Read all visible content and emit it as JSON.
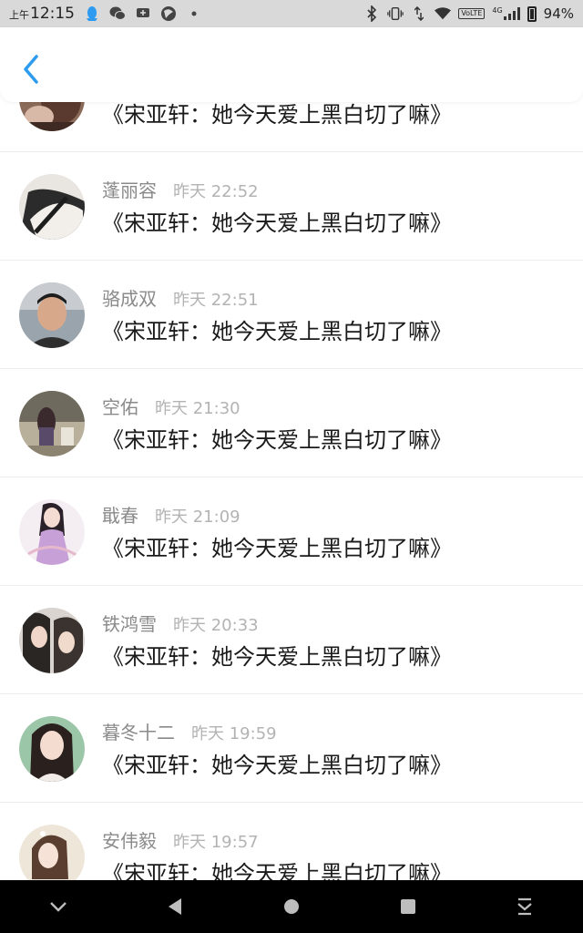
{
  "status_bar": {
    "ampm": "上午",
    "time": "12:15",
    "network": "4G",
    "volte": "VoLTE",
    "battery": "94%"
  },
  "header": {
    "back_icon": "chevron-left-icon",
    "accent": "#2d9cf0"
  },
  "comments": [
    {
      "name": "",
      "time": "",
      "text": "《宋亚轩：她今天爱上黑白切了嘛》"
    },
    {
      "name": "蓬丽容",
      "time": "昨天 22:52",
      "text": "《宋亚轩：她今天爱上黑白切了嘛》"
    },
    {
      "name": "骆成双",
      "time": "昨天 22:51",
      "text": "《宋亚轩：她今天爱上黑白切了嘛》"
    },
    {
      "name": "空佑",
      "time": "昨天 21:30",
      "text": "《宋亚轩：她今天爱上黑白切了嘛》"
    },
    {
      "name": "戢春",
      "time": "昨天 21:09",
      "text": "《宋亚轩：她今天爱上黑白切了嘛》"
    },
    {
      "name": "铁鸿雪",
      "time": "昨天 20:33",
      "text": "《宋亚轩：她今天爱上黑白切了嘛》"
    },
    {
      "name": "暮冬十二",
      "time": "昨天 19:59",
      "text": "《宋亚轩：她今天爱上黑白切了嘛》"
    },
    {
      "name": "安伟毅",
      "time": "昨天 19:57",
      "text": "《宋亚轩：她今天爱上黑白切了嘛》"
    }
  ],
  "nav": [
    "collapse-icon",
    "back-triangle-icon",
    "home-circle-icon",
    "recents-square-icon",
    "notification-pull-icon"
  ]
}
